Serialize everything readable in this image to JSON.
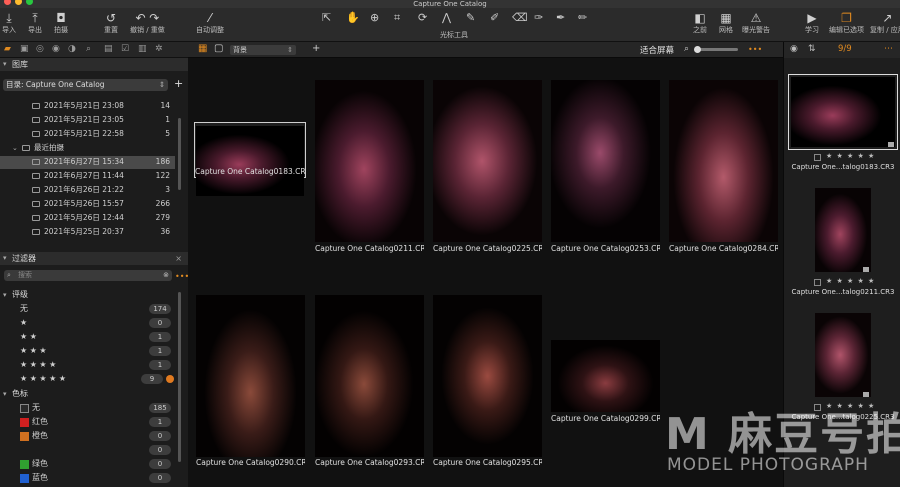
{
  "window_title": "Capture One Catalog",
  "toolbar": {
    "import": "导入",
    "export": "导出",
    "capture": "拍摄",
    "redo": "重置",
    "undo_redo": "撤销 / 重做",
    "auto_adjust": "自动调整",
    "cursor_tools": "光标工具",
    "before": "之前",
    "grid": "网格",
    "exposure_warning": "曝光警告",
    "learn": "学习",
    "edit_selected": "编辑已选项",
    "copy_apply": "复制 / 应用"
  },
  "library": {
    "title": "图库",
    "catalog": "目录: Capture One Catalog",
    "rows": [
      {
        "name": "2021年5月21日 23:08",
        "count": "14"
      },
      {
        "name": "2021年5月21日 23:05",
        "count": "1"
      },
      {
        "name": "2021年5月21日 22:58",
        "count": "5"
      }
    ],
    "recent_folder": "最近拍摄",
    "recent_rows": [
      {
        "name": "2021年6月27日 15:34",
        "count": "186"
      },
      {
        "name": "2021年6月27日 11:44",
        "count": "122"
      },
      {
        "name": "2021年6月26日 21:22",
        "count": "3"
      },
      {
        "name": "2021年5月26日 15:57",
        "count": "266"
      },
      {
        "name": "2021年5月26日 12:44",
        "count": "279"
      },
      {
        "name": "2021年5月25日 20:37",
        "count": "36"
      }
    ]
  },
  "filters": {
    "title": "过滤器",
    "search_placeholder": "搜索",
    "rating_title": "评级",
    "ratings": [
      {
        "label": "无",
        "count": "174"
      },
      {
        "label": "★",
        "count": "0"
      },
      {
        "label": "★ ★",
        "count": "1"
      },
      {
        "label": "★ ★ ★",
        "count": "1"
      },
      {
        "label": "★ ★ ★ ★",
        "count": "1"
      },
      {
        "label": "★ ★ ★ ★ ★",
        "count": "9"
      }
    ],
    "color_title": "色标",
    "colors": [
      {
        "label": "无",
        "count": "185",
        "color": "#2a2a2a"
      },
      {
        "label": "红色",
        "count": "1",
        "color": "#d02020"
      },
      {
        "label": "橙色",
        "count": "0",
        "color": "#d07020"
      },
      {
        "label": "",
        "count": "0",
        "color": "#d0c020"
      },
      {
        "label": "绿色",
        "count": "0",
        "color": "#30a030"
      },
      {
        "label": "蓝色",
        "count": "0",
        "color": "#2060d0"
      }
    ]
  },
  "viewer": {
    "background": "背景",
    "fit_screen": "适合屏幕",
    "thumbnails": [
      "Capture One Catalog0183.CR3",
      "Capture One Catalog0211.CR3",
      "Capture One Catalog0225.CR3",
      "Capture One Catalog0253.CR3",
      "Capture One Catalog0284.CR3",
      "Capture One Catalog0290.CR3",
      "Capture One Catalog0293.CR3",
      "Capture One Catalog0295.CR3",
      "Capture One Catalog0299.CR3"
    ]
  },
  "browser": {
    "count": "9/9",
    "items": [
      {
        "caption": "Capture One...talog0183.CR3",
        "stars": "★ ★ ★ ★ ★"
      },
      {
        "caption": "Capture One...talog0211.CR3",
        "stars": "★ ★ ★ ★ ★"
      },
      {
        "caption": "Capture One...talog0225.CR3",
        "stars": "★ ★ ★ ★ ★"
      }
    ]
  },
  "watermark": {
    "big": "M 麻豆号拍",
    "small": "MODEL PHOTOGRAPH"
  },
  "colors": {
    "accent": "#e08a20"
  }
}
